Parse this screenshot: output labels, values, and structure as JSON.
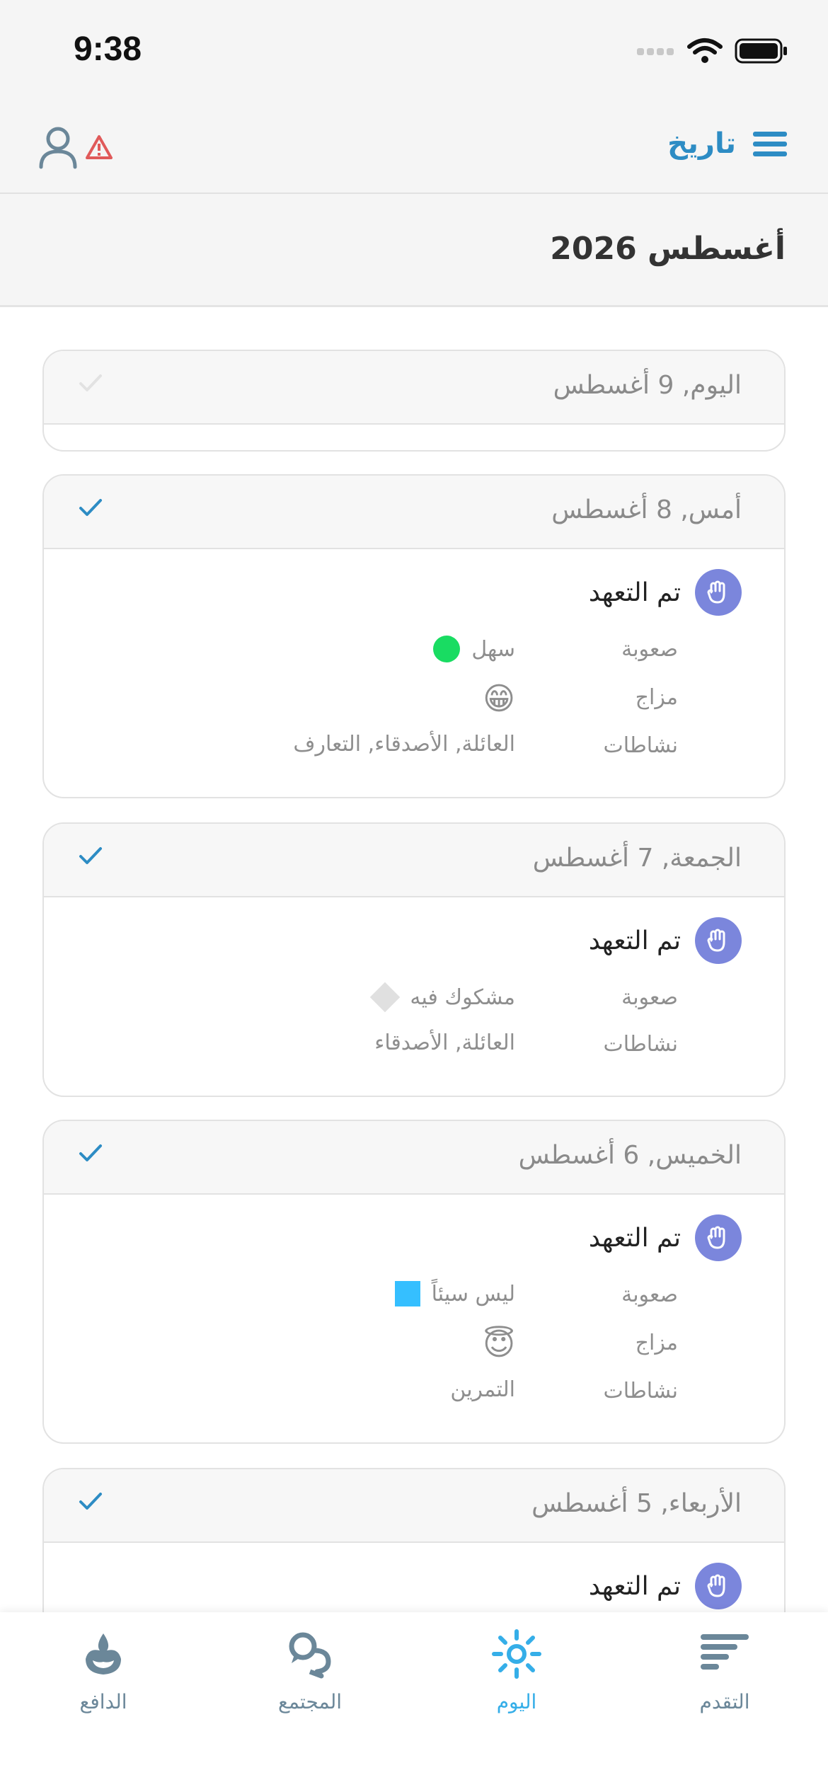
{
  "status_bar": {
    "time": "9:38"
  },
  "nav": {
    "title": "تاريخ"
  },
  "month_header": "أغسطس 2026",
  "entries": [
    {
      "date": "اليوم, 9 أغسطس",
      "completed": false
    },
    {
      "date": "أمس, 8 أغسطس",
      "completed": true,
      "pledge": "تم التعهد",
      "rows": [
        {
          "label": "صعوبة",
          "value": "سهل",
          "marker": "green-dot"
        },
        {
          "label": "مزاج",
          "value": "😁",
          "marker": "emoji"
        },
        {
          "label": "نشاطات",
          "value": "العائلة, الأصدقاء, التعارف"
        }
      ]
    },
    {
      "date": "الجمعة, 7 أغسطس",
      "completed": true,
      "pledge": "تم التعهد",
      "rows": [
        {
          "label": "صعوبة",
          "value": "مشكوك فيه",
          "marker": "grey-diamond"
        },
        {
          "label": "نشاطات",
          "value": "العائلة, الأصدقاء"
        }
      ]
    },
    {
      "date": "الخميس, 6 أغسطس",
      "completed": true,
      "pledge": "تم التعهد",
      "rows": [
        {
          "label": "صعوبة",
          "value": "ليس سيئاً",
          "marker": "blue-square"
        },
        {
          "label": "مزاج",
          "value": "😇",
          "marker": "emoji"
        },
        {
          "label": "نشاطات",
          "value": "التمرين"
        }
      ]
    },
    {
      "date": "الأربعاء, 5 أغسطس",
      "completed": true,
      "pledge": "تم التعهد"
    }
  ],
  "tabs": [
    {
      "label": "الدافع",
      "icon": "motivation-icon"
    },
    {
      "label": "المجتمع",
      "icon": "community-icon"
    },
    {
      "label": "اليوم",
      "icon": "sun-icon",
      "active": true
    },
    {
      "label": "التقدم",
      "icon": "progress-icon"
    }
  ],
  "colors": {
    "accent": "#2d8cc4",
    "active_tab": "#35aee8",
    "pledge_badge": "#7b86dc",
    "easy": "#19dc62",
    "not_bad": "#35bfff",
    "warning": "#e05a5a"
  }
}
